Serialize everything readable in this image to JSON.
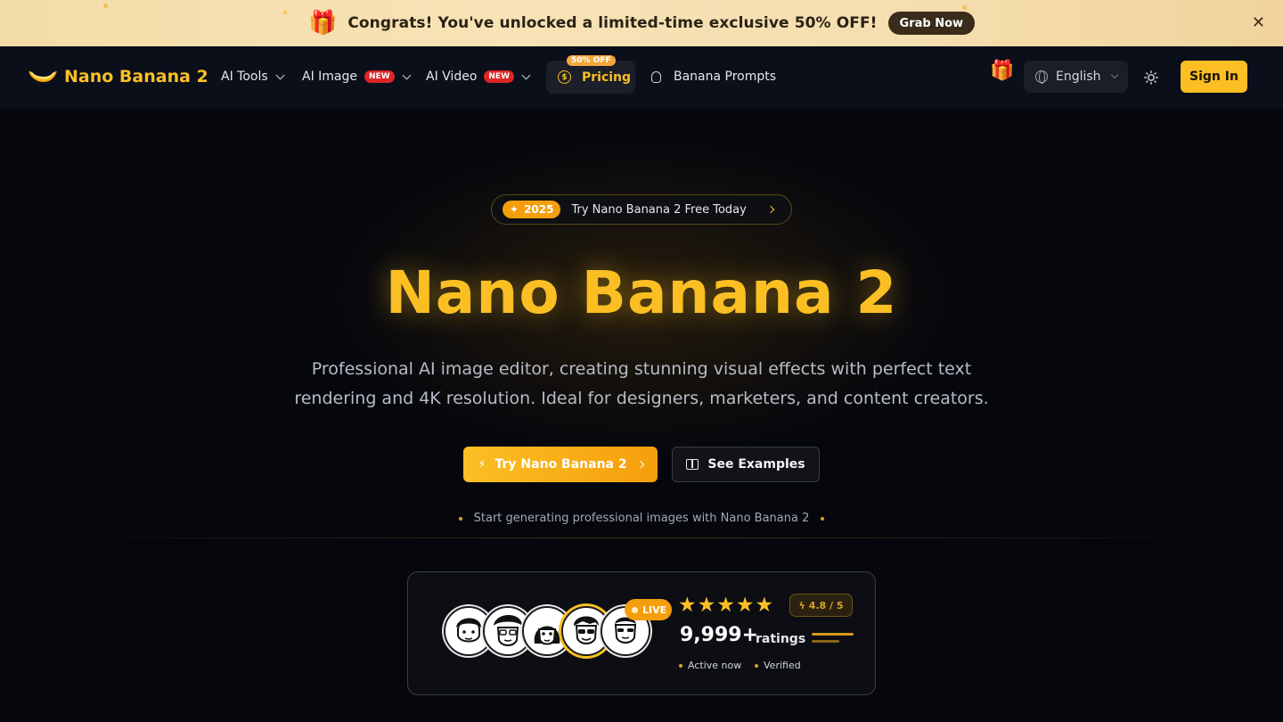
{
  "promo": {
    "text": "Congrats! You've unlocked a limited-time exclusive 50% OFF!",
    "cta": "Grab Now",
    "close": "✕"
  },
  "brand": {
    "name": "Nano Banana 2",
    "accent": "#fbbf24"
  },
  "nav": {
    "items": [
      {
        "label": "AI Tools",
        "badge": ""
      },
      {
        "label": "AI Image",
        "badge": "NEW"
      },
      {
        "label": "AI Video",
        "badge": "NEW"
      }
    ],
    "pricing": {
      "label": "Pricing",
      "badge": "50% OFF"
    },
    "prompts": "Banana Prompts",
    "language": "English",
    "sign_in": "Sign In"
  },
  "hero": {
    "pill_year": "2025",
    "pill_text": "Try Nano Banana 2 Free Today",
    "title": "Nano Banana 2",
    "subtitle": "Professional AI image editor, creating stunning visual effects with perfect text rendering and 4K resolution. Ideal for designers, marketers, and content creators.",
    "primary_cta": "Try Nano Banana 2",
    "secondary_cta": "See Examples",
    "start_text": "Start generating professional images with Nano Banana 2"
  },
  "social_proof": {
    "live": "LIVE",
    "score": "4.8 / 5",
    "stars": 5,
    "ratings_count": "9,999+",
    "ratings_label": "ratings",
    "active": "Active now",
    "verified": "Verified"
  }
}
